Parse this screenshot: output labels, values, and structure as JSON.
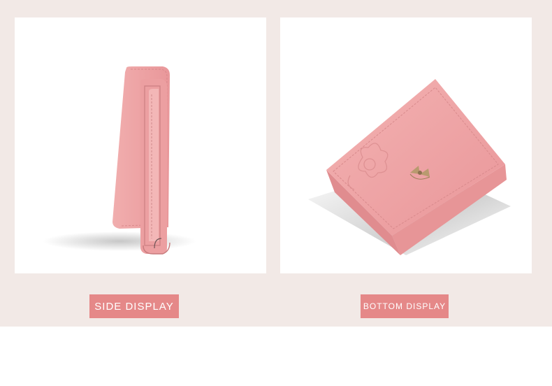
{
  "panels": {
    "side": {
      "caption": "SIDE DISPLAY",
      "image": "pink-wallet-side-view"
    },
    "bottom": {
      "caption": "BOTTOM DISPLAY",
      "image": "pink-wallet-angled-view"
    }
  },
  "colors": {
    "background_band": "#f2e9e6",
    "panel": "#ffffff",
    "label_bg": "#e58888",
    "label_text": "#ffffff",
    "wallet_pink": "#eea3a4"
  }
}
